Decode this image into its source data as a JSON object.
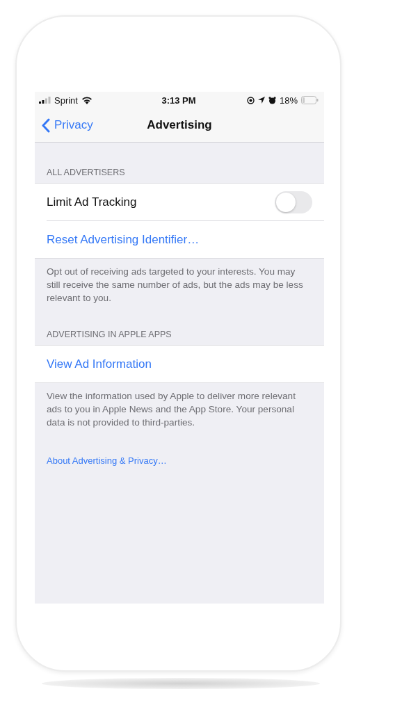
{
  "status_bar": {
    "carrier": "Sprint",
    "time": "3:13 PM",
    "battery": "18%"
  },
  "nav_bar": {
    "back": "Privacy",
    "title": "Advertising"
  },
  "sections": [
    {
      "header": "ALL ADVERTISERS",
      "rows": [
        {
          "kind": "toggle",
          "label": "Limit Ad Tracking",
          "on": false
        },
        {
          "kind": "link",
          "label": "Reset Advertising Identifier…"
        }
      ],
      "footer": "Opt out of receiving ads targeted to your interests. You may still receive the same number of ads, but the ads may be less relevant to you."
    },
    {
      "header": "ADVERTISING IN APPLE APPS",
      "rows": [
        {
          "kind": "link",
          "label": "View Ad Information"
        }
      ],
      "footer": "View the information used by Apple to deliver more relevant ads to you in Apple News and the App Store. Your personal data is not provided to third-parties."
    }
  ],
  "about_link": "About Advertising & Privacy…"
}
